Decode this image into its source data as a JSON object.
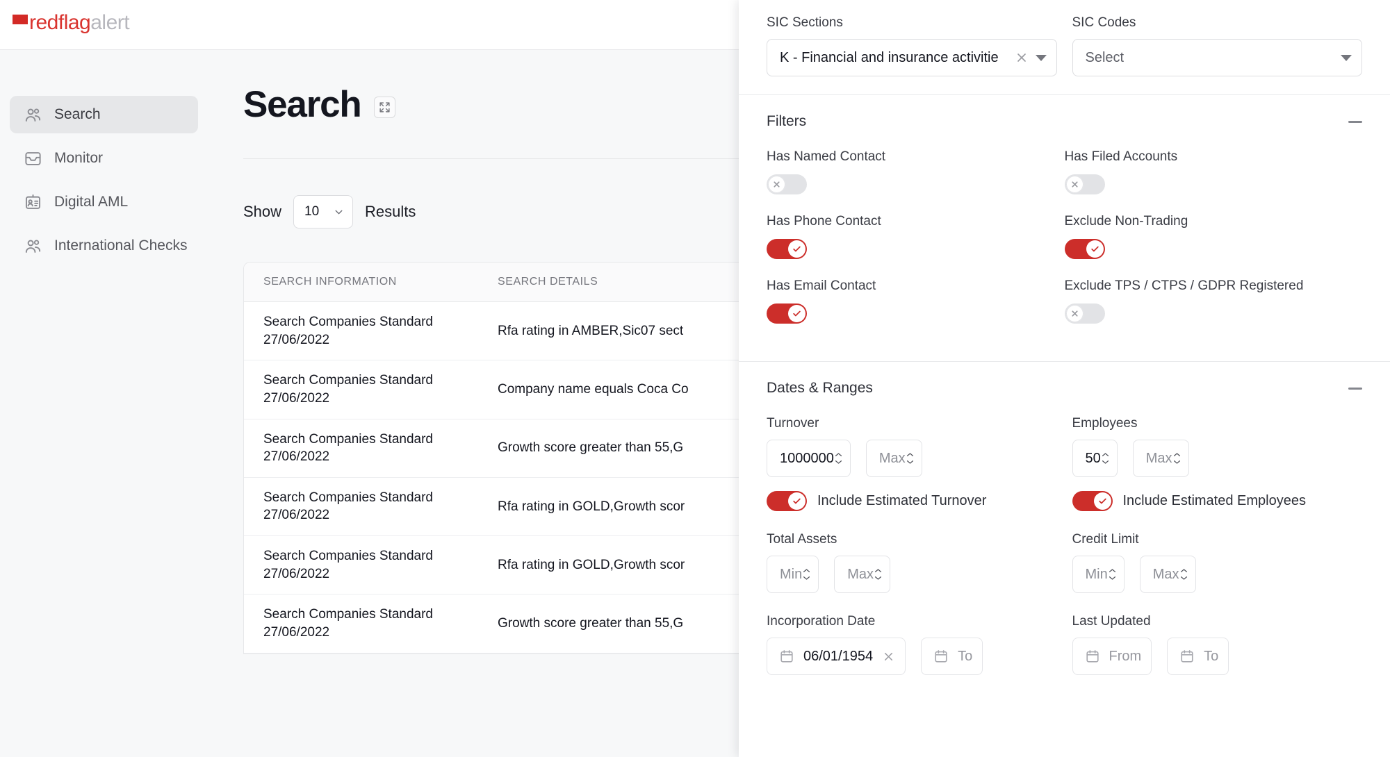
{
  "brand": {
    "name_red": "redflag",
    "name_grey": "alert"
  },
  "sidebar": {
    "items": [
      {
        "label": "Search",
        "icon": "users-icon"
      },
      {
        "label": "Monitor",
        "icon": "inbox-icon"
      },
      {
        "label": "Digital AML",
        "icon": "id-card-icon"
      },
      {
        "label": "International Checks",
        "icon": "users-icon"
      }
    ]
  },
  "main": {
    "title": "Search",
    "show_label": "Show",
    "show_value": "10",
    "results_label": "Results",
    "table": {
      "columns": [
        "SEARCH INFORMATION",
        "SEARCH DETAILS"
      ],
      "rows": [
        {
          "name": "Search Companies Standard",
          "date": "27/06/2022",
          "details": "Rfa rating in AMBER,Sic07 sect"
        },
        {
          "name": "Search Companies Standard",
          "date": "27/06/2022",
          "details": "Company name equals Coca Co"
        },
        {
          "name": "Search Companies Standard",
          "date": "27/06/2022",
          "details": "Growth score greater than 55,G"
        },
        {
          "name": "Search Companies Standard",
          "date": "27/06/2022",
          "details": "Rfa rating in GOLD,Growth scor"
        },
        {
          "name": "Search Companies Standard",
          "date": "27/06/2022",
          "details": "Rfa rating in GOLD,Growth scor"
        },
        {
          "name": "Search Companies Standard",
          "date": "27/06/2022",
          "details": "Growth score greater than 55,G"
        }
      ]
    }
  },
  "panel": {
    "sic_sections": {
      "label": "SIC Sections",
      "value": "K - Financial and insurance activitie"
    },
    "sic_codes": {
      "label": "SIC Codes",
      "value": "Select"
    },
    "filters": {
      "title": "Filters",
      "items": [
        {
          "label": "Has Named Contact",
          "state": "off"
        },
        {
          "label": "Has Filed Accounts",
          "state": "off"
        },
        {
          "label": "Has Phone Contact",
          "state": "on"
        },
        {
          "label": "Exclude Non-Trading",
          "state": "on"
        },
        {
          "label": "Has Email Contact",
          "state": "on"
        },
        {
          "label": "Exclude TPS / CTPS / GDPR Registered",
          "state": "off"
        }
      ]
    },
    "dates_ranges": {
      "title": "Dates & Ranges",
      "turnover": {
        "label": "Turnover",
        "min_value": "1000000",
        "max_placeholder": "Max",
        "toggle_label": "Include Estimated Turnover",
        "toggle_state": "on"
      },
      "employees": {
        "label": "Employees",
        "min_value": "50",
        "max_placeholder": "Max",
        "toggle_label": "Include Estimated Employees",
        "toggle_state": "on"
      },
      "total_assets": {
        "label": "Total Assets",
        "min_placeholder": "Min",
        "max_placeholder": "Max"
      },
      "credit_limit": {
        "label": "Credit Limit",
        "min_placeholder": "Min",
        "max_placeholder": "Max"
      },
      "incorporation_date": {
        "label": "Incorporation Date",
        "from_value": "06/01/1954",
        "to_placeholder": "To"
      },
      "last_updated": {
        "label": "Last Updated",
        "from_placeholder": "From",
        "to_placeholder": "To"
      }
    }
  },
  "colors": {
    "brand_red": "#cc2e2a",
    "logo_red": "#d9342f",
    "toggle_off": "#e2e3e6"
  }
}
